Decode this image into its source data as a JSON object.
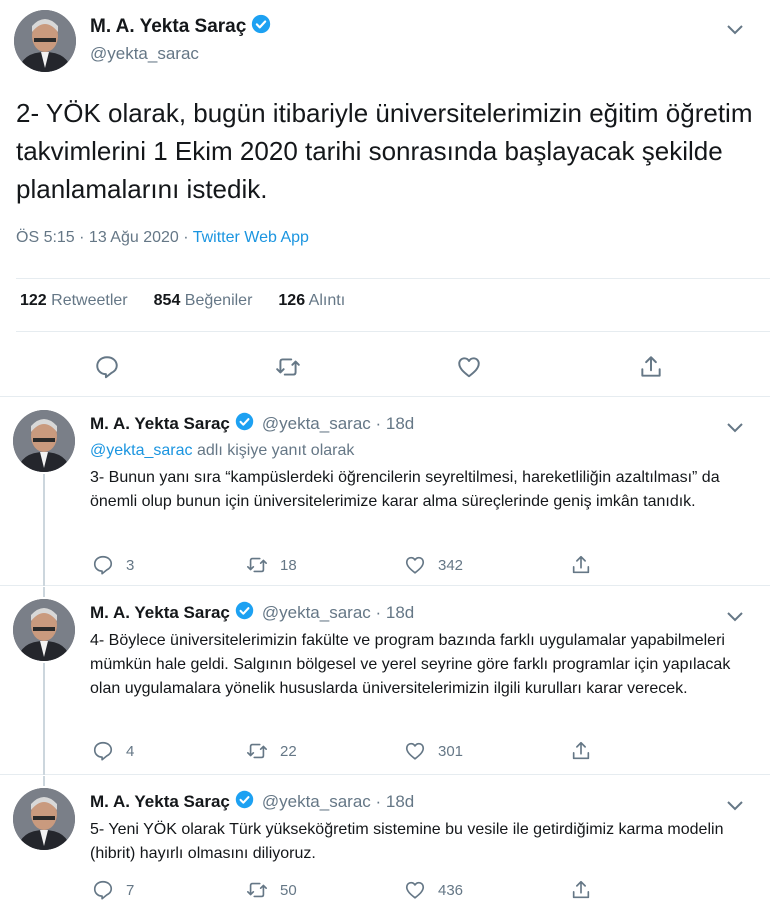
{
  "main_tweet": {
    "author_name": "M. A. Yekta Saraç",
    "author_handle": "@yekta_sarac",
    "text": "2- YÖK olarak, bugün itibariyle üniversitelerimizin eğitim öğretim takvimlerini 1 Ekim 2020 tarihi sonrasında başlayacak şekilde planlamalarını istedik.",
    "time": "ÖS 5:15 · 13 Ağu 2020 · ",
    "source": "Twitter Web App",
    "stats": {
      "retweets_count": "122",
      "retweets_label": "Retweetler",
      "likes_count": "854",
      "likes_label": "Beğeniler",
      "quotes_count": "126",
      "quotes_label": "Alıntı"
    }
  },
  "replies": [
    {
      "author_name": "M. A. Yekta Saraç",
      "author_handle": "@yekta_sarac · 18d",
      "replying_to_handle": "@yekta_sarac",
      "replying_to_suffix": " adlı kişiye yanıt olarak",
      "text": "3- Bunun yanı sıra “kampüslerdeki öğrencilerin seyreltilmesi, hareketliliğin azaltılması” da önemli olup bunun için üniversitelerimize karar alma süreçlerinde geniş imkân tanıdık.",
      "reply_count": "3",
      "retweet_count": "18",
      "like_count": "342"
    },
    {
      "author_name": "M. A. Yekta Saraç",
      "author_handle": "@yekta_sarac · 18d",
      "text": "4- Böylece üniversitelerimizin fakülte ve program bazında farklı uygulamalar yapabilmeleri mümkün hale geldi. Salgının bölgesel ve yerel seyrine göre farklı programlar için yapılacak olan uygulamalara yönelik hususlarda üniversitelerimizin ilgili kurulları karar verecek.",
      "reply_count": "4",
      "retweet_count": "22",
      "like_count": "301"
    },
    {
      "author_name": "M. A. Yekta Saraç",
      "author_handle": "@yekta_sarac · 18d",
      "text": "5- Yeni YÖK olarak Türk yükseköğretim sistemine bu vesile ile getirdiğimiz karma modelin (hibrit) hayırlı olmasını diliyoruz.",
      "reply_count": "7",
      "retweet_count": "50",
      "like_count": "436"
    }
  ],
  "icons": {
    "verified": "verified-badge-icon",
    "menu": "chevron-down-icon",
    "reply": "reply-icon",
    "retweet": "retweet-icon",
    "like": "heart-icon",
    "share": "share-icon"
  },
  "colors": {
    "accent": "#1b95e0",
    "text": "#14171a",
    "secondary": "#657786",
    "border": "#e6ecf0"
  }
}
